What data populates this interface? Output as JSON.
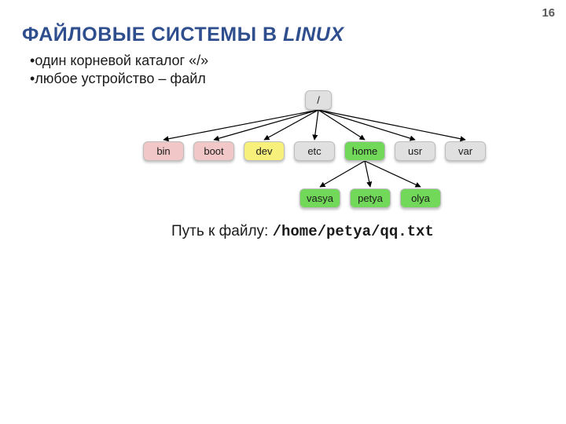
{
  "page_number": "16",
  "title_plain": "ФАЙЛОВЫЕ СИСТЕМЫ В ",
  "title_em": "LINUX",
  "bullets": [
    "один корневой каталог «/»",
    "любое устройство – файл"
  ],
  "nodes": {
    "root": "/",
    "bin": "bin",
    "boot": "boot",
    "dev": "dev",
    "etc": "etc",
    "home": "home",
    "usr": "usr",
    "var": "var",
    "vasya": "vasya",
    "petya": "petya",
    "olya": "olya"
  },
  "path_label": "Путь к файлу: ",
  "path_value": "/home/petya/qq.txt",
  "colors": {
    "title": "#2f4e8e",
    "gray": "#e0e0e0",
    "pink": "#f1c7c7",
    "yellow": "#f7f07a",
    "green": "#72d85a"
  }
}
